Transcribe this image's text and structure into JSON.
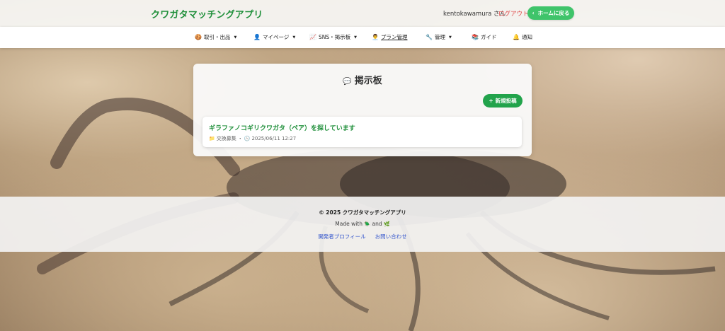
{
  "header": {
    "brand": "クワガタマッチングアプリ",
    "user": "kentokawamura さん",
    "logout": "ログアウト",
    "home_button_icon": "‹",
    "home_button": "ホームに戻る"
  },
  "nav": {
    "items": [
      {
        "icon": "🍪",
        "label": "取引・出品",
        "caret": "▼"
      },
      {
        "icon": "👤",
        "label": "マイページ",
        "caret": "▼"
      },
      {
        "icon": "📈",
        "label": "SNS・掲示板",
        "caret": "▼"
      },
      {
        "icon": "👨‍💼",
        "label": "プラン管理"
      },
      {
        "icon": "🔧",
        "label": "管理",
        "caret": "▼"
      },
      {
        "icon": "📚",
        "label": "ガイド"
      },
      {
        "icon": "🔔",
        "label": "通知"
      }
    ]
  },
  "board": {
    "icon": "💬",
    "title": "掲示板",
    "new_post_icon": "+",
    "new_post": "新規投稿",
    "posts": [
      {
        "title": "ギラファノコギリクワガタ（ペア）を探しています",
        "category_icon": "📁",
        "category": "交換募集",
        "separator": "・",
        "clock_icon": "🕓",
        "date": "2025/06/11 12:27"
      }
    ]
  },
  "footer": {
    "copyright": "© 2025 クワガタマッチングアプリ",
    "made_prefix": "Made with",
    "made_icon1": "🪲",
    "made_and": "and",
    "made_icon2": "🌿",
    "links": [
      "開発者プロフィール",
      "お問い合わせ"
    ]
  }
}
